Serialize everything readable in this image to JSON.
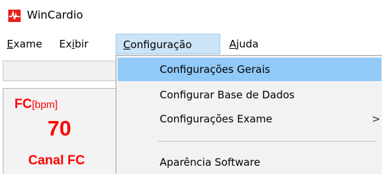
{
  "window": {
    "title": "WinCardio"
  },
  "menubar": {
    "items": [
      {
        "first": "E",
        "rest": "xame"
      },
      {
        "first": "Ex",
        "rest_u": "i",
        "rest": "bir"
      },
      {
        "first": "C",
        "rest": "onfiguração"
      },
      {
        "first": "A",
        "rest": "juda"
      }
    ]
  },
  "panel": {
    "fc_label": "FC",
    "fc_unit": "[bpm]",
    "fc_value": "70",
    "channel": "Canal FC"
  },
  "dropdown": {
    "items": [
      {
        "label": "Configurações Gerais",
        "highlighted": true
      },
      {
        "label": "Configurar Base de Dados"
      },
      {
        "label": "Configurações Exame",
        "submenu_arrow": ">"
      },
      {
        "label": "Aparência Software"
      }
    ]
  },
  "colors": {
    "accent_red": "#ff0000",
    "menu_highlight": "#cce4f7",
    "item_highlight": "#91c9f7"
  },
  "icons": {
    "app": "wincardio-heartbeat-icon",
    "submenu": "chevron-right-icon"
  }
}
